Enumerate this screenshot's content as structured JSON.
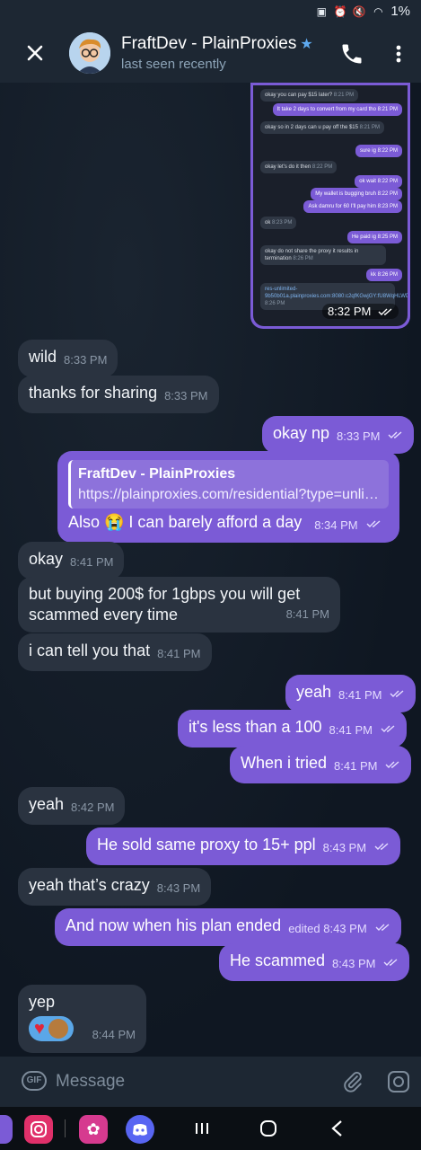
{
  "status_bar": {
    "battery": "1%"
  },
  "header": {
    "title": "FraftDev - PlainProxies",
    "subtitle": "last seen recently"
  },
  "image_message": {
    "lines": [
      {
        "side": "in",
        "text": "okay you can pay $15 later?",
        "time": "8:21 PM"
      },
      {
        "side": "out",
        "text": "It take 2 days to convert from my card tho",
        "time": "8:21 PM"
      },
      {
        "side": "in",
        "text": "okay so in 2 days can u pay off the $15",
        "time": "8:21 PM"
      },
      {
        "side": "out",
        "text": "sure ig",
        "time": "8:22 PM"
      },
      {
        "side": "in",
        "text": "okay let's do it then",
        "time": "8:22 PM"
      },
      {
        "side": "out",
        "text": "ok wait",
        "time": "8:22 PM"
      },
      {
        "side": "out",
        "text": "My wallet is bugging bruh",
        "time": "8:22 PM"
      },
      {
        "side": "out",
        "text": "Ask damru for 60 I'll pay him",
        "time": "8:23 PM"
      },
      {
        "side": "in",
        "text": "ok",
        "time": "8:23 PM"
      },
      {
        "side": "out",
        "text": "He paid ig",
        "time": "8:25 PM"
      },
      {
        "side": "in",
        "text": "okay do not share the proxy it results in termination",
        "time": "8:26 PM"
      },
      {
        "side": "out",
        "text": "kk",
        "time": "8:26 PM"
      },
      {
        "side": "link",
        "text": "res-unlimited-9b50b01a.plainproxies.com:8080:c2qfKGwjGY:fU8WqHLWDI14Adadb",
        "time": "8:26 PM"
      }
    ],
    "time": "8:32 PM"
  },
  "messages": [
    {
      "side": "in",
      "text": "wild",
      "time": "8:33 PM"
    },
    {
      "side": "in",
      "text": "thanks for sharing",
      "time": "8:33 PM"
    },
    {
      "side": "out",
      "text": "okay np",
      "time": "8:33 PM"
    },
    {
      "side": "out",
      "reply_name": "FraftDev - PlainProxies",
      "reply_text": "https://plainproxies.com/residential?type=unli…",
      "text": "Also 😭 I can barely afford a day",
      "time": "8:34 PM"
    },
    {
      "side": "in",
      "text": "okay",
      "time": "8:41 PM"
    },
    {
      "side": "in",
      "text_line1": "but buying 200$ for 1gbps you will get",
      "text_line2": "scammed every time",
      "time": "8:41 PM"
    },
    {
      "side": "in",
      "text": "i can tell you that",
      "time": "8:41 PM"
    },
    {
      "side": "out",
      "text": "yeah",
      "time": "8:41 PM"
    },
    {
      "side": "out",
      "text": "it's less than a 100",
      "time": "8:41 PM"
    },
    {
      "side": "out",
      "text": "When i tried",
      "time": "8:41 PM"
    },
    {
      "side": "in",
      "text": "yeah",
      "time": "8:42 PM"
    },
    {
      "side": "out",
      "text": "He sold same proxy to 15+ ppl",
      "time": "8:43 PM"
    },
    {
      "side": "in",
      "text": "yeah that’s crazy",
      "time": "8:43 PM"
    },
    {
      "side": "out",
      "text": "And now when his plan ended",
      "edited": "edited",
      "time": "8:43 PM"
    },
    {
      "side": "out",
      "text": "He scammed",
      "time": "8:43 PM"
    },
    {
      "side": "in",
      "text": "yep",
      "time": "8:44 PM"
    }
  ],
  "input": {
    "placeholder": "Message"
  },
  "colors": {
    "outgoing": "#7b5bd6",
    "incoming": "#2a3340",
    "accent": "#5eaaf0"
  }
}
